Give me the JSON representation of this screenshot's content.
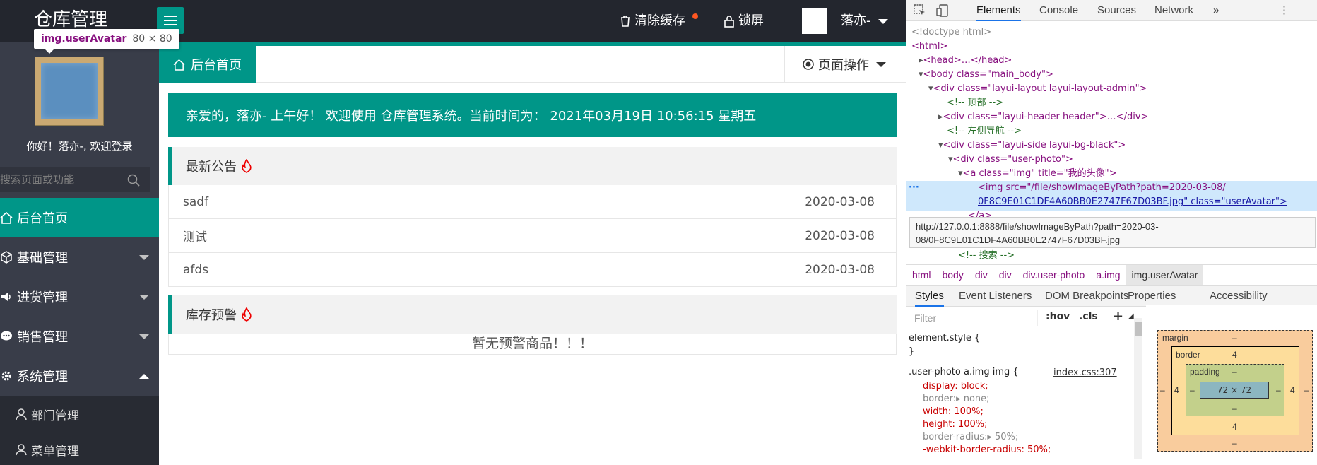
{
  "header": {
    "logo": "仓库管理",
    "menu_icon": "hamburger-icon",
    "clear_cache": "清除缓存",
    "lock": "锁屏",
    "user_name": "落亦-"
  },
  "tooltip": {
    "tag": "img.userAvatar",
    "size": "80 × 80"
  },
  "sidebar": {
    "greeting": "你好！落亦-, 欢迎登录",
    "search_placeholder": "搜索页面或功能",
    "items": [
      {
        "label": "后台首页",
        "icon": "home-icon",
        "active": true
      },
      {
        "label": "基础管理",
        "icon": "cube-icon"
      },
      {
        "label": "进货管理",
        "icon": "speaker-icon"
      },
      {
        "label": "销售管理",
        "icon": "chat-icon"
      },
      {
        "label": "系统管理",
        "icon": "gear-icon",
        "expanded": true
      }
    ],
    "sub_items": [
      {
        "label": "部门管理",
        "icon": "user-icon"
      },
      {
        "label": "菜单管理",
        "icon": "user-icon"
      }
    ]
  },
  "tabs": {
    "home": "后台首页",
    "page_ops": "页面操作"
  },
  "welcome": "亲爱的，落亦- 上午好！ 欢迎使用 仓库管理系统。当前时间为： 2021年03月19日 10:56:15   星期五",
  "notice": {
    "title": "最新公告",
    "rows": [
      {
        "title": "sadf",
        "date": "2020-03-08"
      },
      {
        "title": "测试",
        "date": "2020-03-08"
      },
      {
        "title": "afds",
        "date": "2020-03-08"
      }
    ]
  },
  "stock": {
    "title": "库存预警",
    "empty": "暂无预警商品！！！"
  },
  "devtools": {
    "tabs": [
      "Elements",
      "Console",
      "Sources",
      "Network",
      "»"
    ],
    "dom": {
      "doctype": "<!doctype html>",
      "html": "<html>",
      "head": "<head>…</head>",
      "body": "<body class=\"main_body\">",
      "layout": "<div class=\"layui-layout layui-layout-admin\">",
      "c_top": "<!-- 顶部 -->",
      "header_div": "<div class=\"layui-header header\">…</div>",
      "c_nav": "<!-- 左侧导航 -->",
      "side_div": "<div class=\"layui-side layui-bg-black\">",
      "photo_div": "<div class=\"user-photo\">",
      "a_img": "<a class=\"img\" title=\"我的头像\">",
      "img_line1": "<img src=\"/file/showImageByPath?path=2020-03-08/",
      "img_line2": "0F8C9E01C1DF4A60BB0E2747F67D03BF.jpg\" class=\"userAvatar\">",
      "a_close": "</a>",
      "c_search": "<!-- 搜索 -->"
    },
    "url_tip_1": "http://127.0.0.1:8888/file/showImageByPath?path=2020-03-",
    "url_tip_2": "08/0F8C9E01C1DF4A60BB0E2747F67D03BF.jpg",
    "breadcrumbs": [
      "html",
      "body",
      "div",
      "div",
      "div.user-photo",
      "a.img",
      "img.userAvatar"
    ],
    "panel_tabs": [
      "Styles",
      "Event Listeners",
      "DOM Breakpoints",
      "Properties",
      "Accessibility"
    ],
    "filter_placeholder": "Filter",
    "hov": ":hov",
    "cls": ".cls",
    "plus": "+",
    "css": {
      "element_style": "element.style {",
      "close": "}",
      "selector": ".user-photo a.img img {",
      "link": "index.css:307",
      "decl": [
        "display: block;",
        "border:▸ none;",
        "width: 100%;",
        "height: 100%;",
        "border-radius:▸ 50%;",
        "-webkit-border-radius: 50%;"
      ]
    },
    "box_model": {
      "margin": "margin",
      "border": "border",
      "padding": "padding",
      "dash": "–",
      "border_val": "4",
      "content": "72 × 72"
    }
  }
}
